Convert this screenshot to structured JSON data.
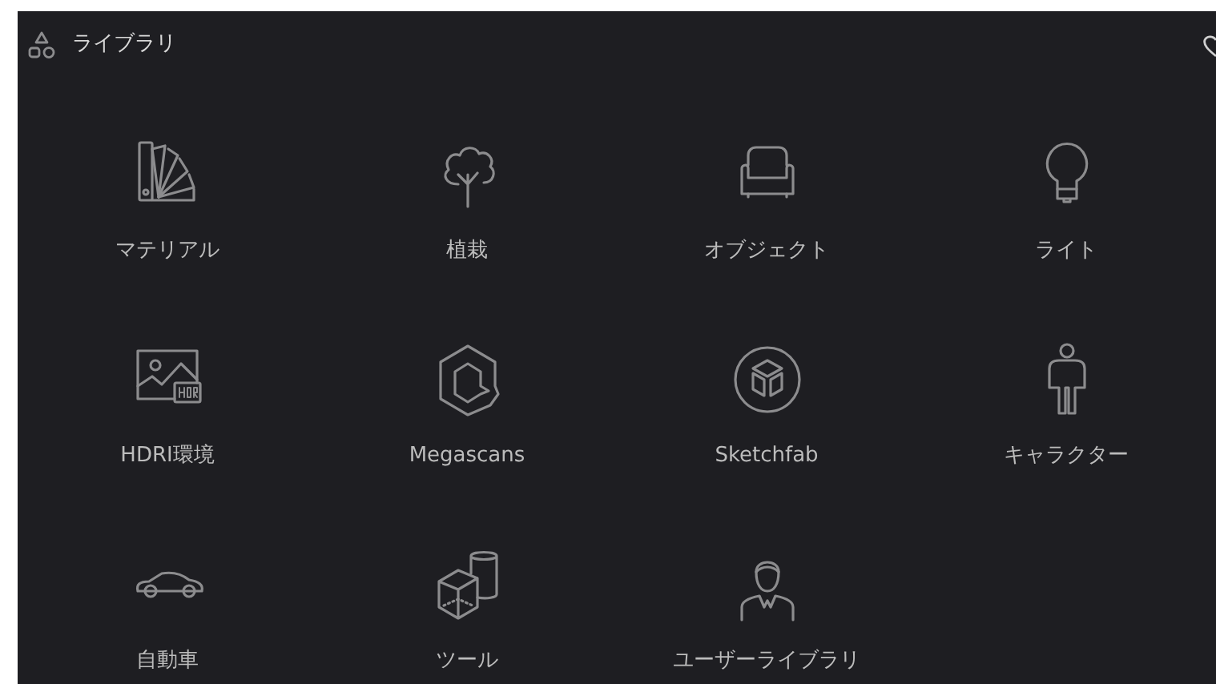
{
  "header": {
    "title": "ライブラリ"
  },
  "items": [
    {
      "label": "マテリアル"
    },
    {
      "label": "植栽"
    },
    {
      "label": "オブジェクト"
    },
    {
      "label": "ライト"
    },
    {
      "label": "HDRI環境"
    },
    {
      "label": "Megascans"
    },
    {
      "label": "Sketchfab"
    },
    {
      "label": "キャラクター"
    },
    {
      "label": "自動車"
    },
    {
      "label": "ツール"
    },
    {
      "label": "ユーザーライブラリ"
    }
  ]
}
